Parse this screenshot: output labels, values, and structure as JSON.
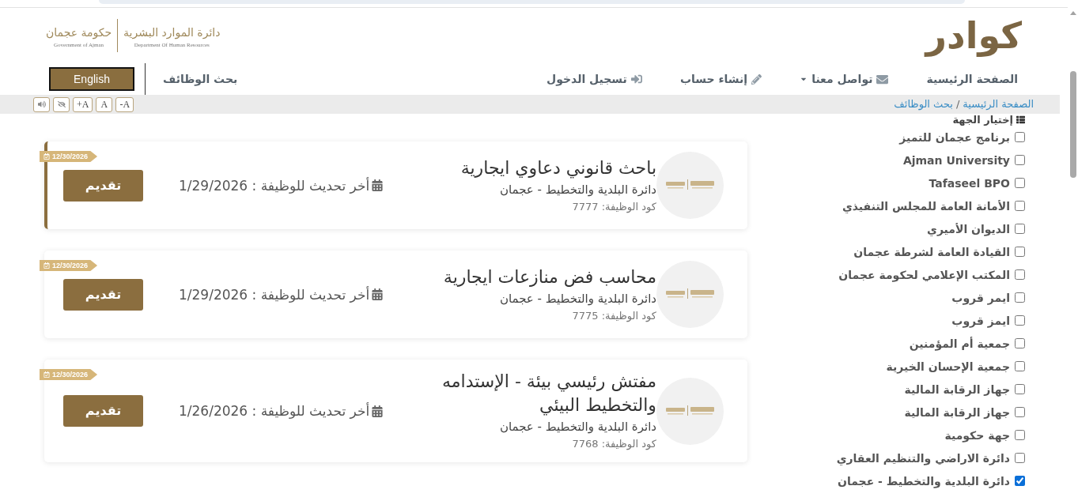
{
  "header": {
    "brand_logo": "كوادر",
    "partner_logo": {
      "department_ar": "دائرة الموارد البشرية",
      "department_en": "Department Of Human Resources",
      "government_ar": "حكومة عجمان",
      "government_en": "Government of Ajman"
    }
  },
  "nav": {
    "items": [
      {
        "kind": "home",
        "label": "الصفحة الرئيسية"
      },
      {
        "kind": "contact",
        "label": "تواصل معنا"
      },
      {
        "kind": "register",
        "label": "إنشاء حساب"
      },
      {
        "kind": "login",
        "label": "تسجيل الدخول"
      }
    ],
    "job_search": "بحث الوظائف",
    "language_button": "English"
  },
  "breadcrumb": {
    "items": [
      "الصفحة الرئيسية",
      "بحث الوظائف"
    ],
    "separator": "/"
  },
  "accessibility_tools": [
    {
      "kind": "font-smaller",
      "label": "-A"
    },
    {
      "kind": "font-reset",
      "label": "A"
    },
    {
      "kind": "font-larger",
      "label": "+A"
    },
    {
      "kind": "contrast"
    },
    {
      "kind": "audio"
    }
  ],
  "filter": {
    "title": "إختيار الجهة",
    "options": [
      {
        "label": "برنامج عجمان للتميز",
        "checked": false
      },
      {
        "label": "Ajman University",
        "checked": false
      },
      {
        "label": "Tafaseel BPO",
        "checked": false
      },
      {
        "label": "الأمانة العامة للمجلس التنفيذي",
        "checked": false
      },
      {
        "label": "الديوان الأميري",
        "checked": false
      },
      {
        "label": "القيادة العامة لشرطة عجمان",
        "checked": false
      },
      {
        "label": "المكتب الإعلامي لحكومة عجمان",
        "checked": false
      },
      {
        "label": "ايمر قروب",
        "checked": false
      },
      {
        "label": "ايمز قروب",
        "checked": false
      },
      {
        "label": "جمعية أم المؤمنين",
        "checked": false
      },
      {
        "label": "جمعية الإحسان الخيرية",
        "checked": false
      },
      {
        "label": "جهاز الرقابة المالية",
        "checked": false
      },
      {
        "label": "جهاز الرقابة المالية",
        "checked": false
      },
      {
        "label": "جهة حكومية",
        "checked": false
      },
      {
        "label": "دائرة الاراضي والتنظيم العقاري",
        "checked": false
      },
      {
        "label": "دائرة البلدية والتخطيط - عجمان",
        "checked": true
      }
    ]
  },
  "jobs": [
    {
      "title": "باحث قانوني دعاوي ايجارية",
      "department": "دائرة البلدية والتخطيط - عجمان",
      "code": "كود الوظيفة: 7777",
      "updated": "أخر تحديث للوظيفة : 1/29/2026",
      "deadline": "12/30/2026",
      "apply": "تقديم",
      "selected": true
    },
    {
      "title": "محاسب فض منازعات ايجارية",
      "department": "دائرة البلدية والتخطيط - عجمان",
      "code": "كود الوظيفة: 7775",
      "updated": "أخر تحديث للوظيفة : 1/29/2026",
      "deadline": "12/30/2026",
      "apply": "تقديم",
      "selected": false
    },
    {
      "title": "مفتش رئيسي بيئة - الإستدامه والتخطيط البيئي",
      "department": "دائرة البلدية والتخطيط - عجمان",
      "code": "كود الوظيفة: 7768",
      "updated": "أخر تحديث للوظيفة : 1/26/2026",
      "deadline": "12/30/2026",
      "apply": "تقديم",
      "selected": false
    }
  ]
}
